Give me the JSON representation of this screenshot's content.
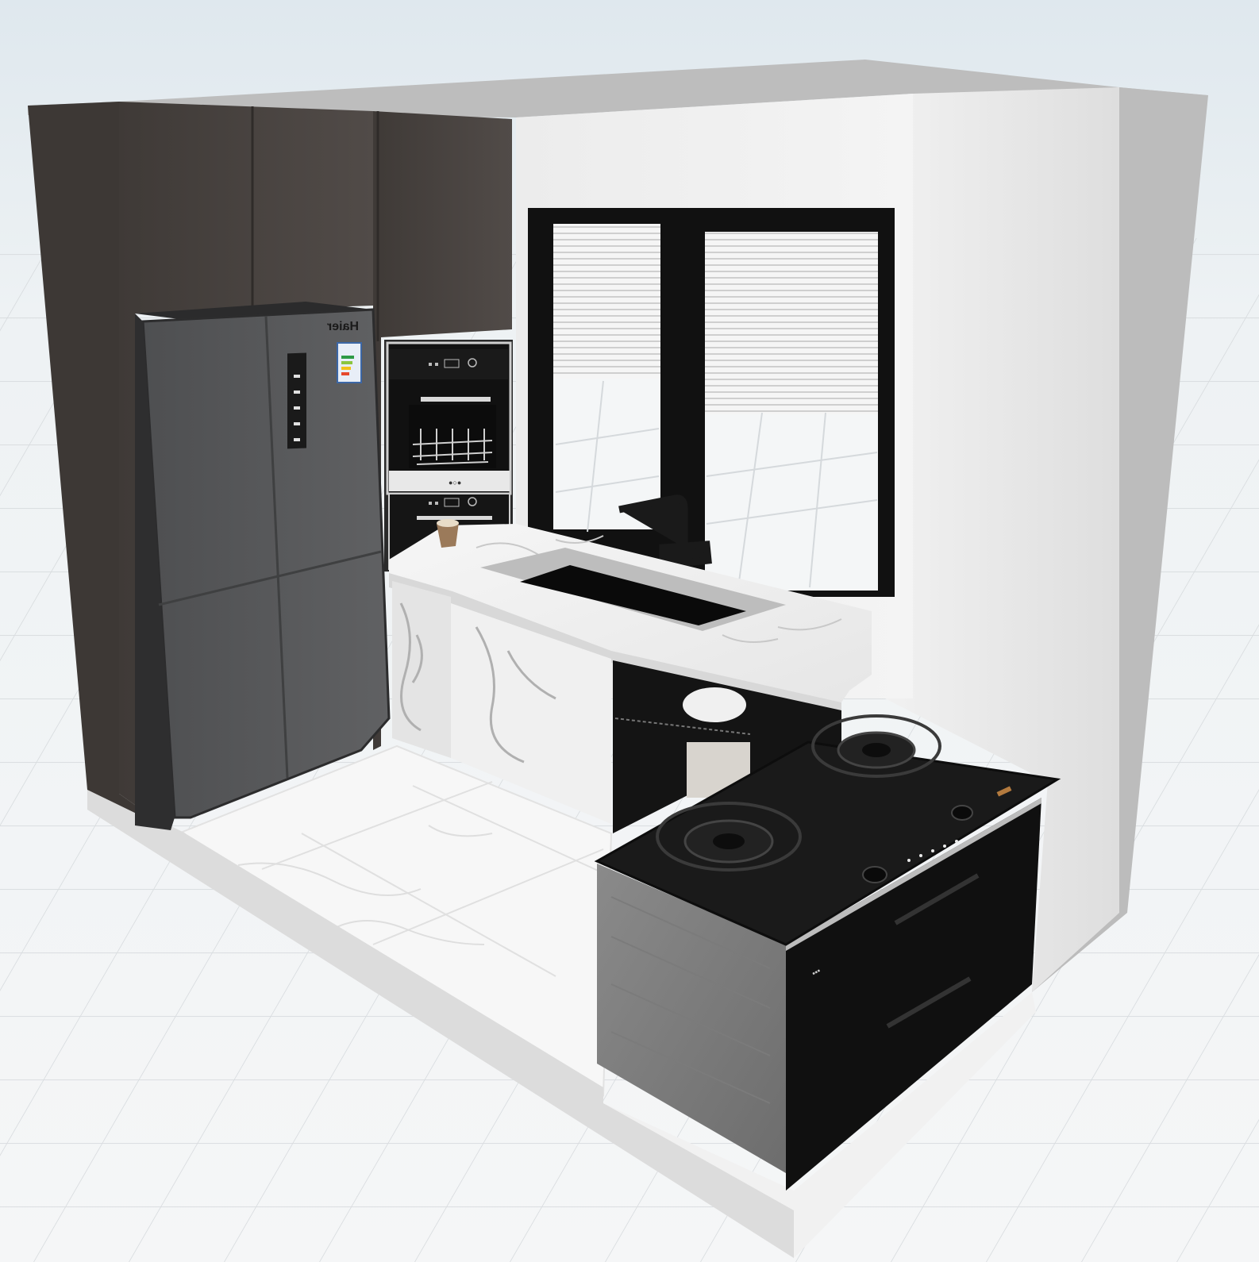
{
  "scene": {
    "type": "3d-kitchen-render",
    "colors": {
      "sky": "#e7edf1",
      "ground": "#f3f4f5",
      "grid": "#d9dde0",
      "wall": "#d7d7d7",
      "wall_inner": "#e2e2e2",
      "tall_cabinet": "#4a4542",
      "fridge": "#575859",
      "marble": "#f0f0f0",
      "black": "#151515",
      "cooktop": "#1a1a1a"
    }
  },
  "fridge": {
    "brand": "Haier"
  },
  "oven": {
    "brand": "●○●"
  },
  "stove": {
    "brand": "▪▪▪"
  }
}
